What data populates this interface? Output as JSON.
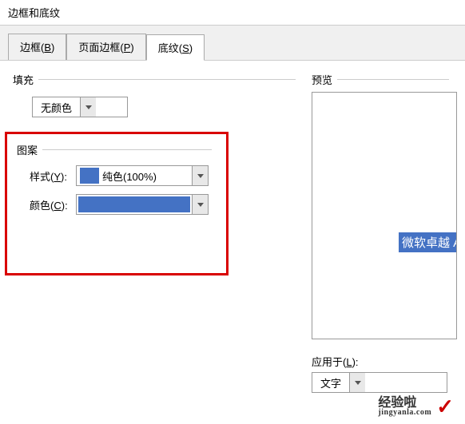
{
  "window": {
    "title": "边框和底纹"
  },
  "tabs": {
    "border": {
      "label": "边框(",
      "key": "B",
      "suffix": ")"
    },
    "page_border": {
      "label": "页面边框(",
      "key": "P",
      "suffix": ")"
    },
    "shading": {
      "label": "底纹(",
      "key": "S",
      "suffix": ")"
    }
  },
  "fill": {
    "group_label": "填充",
    "value": "无颜色"
  },
  "pattern": {
    "group_label": "图案",
    "style": {
      "label": "样式(",
      "key": "Y",
      "suffix": "):",
      "value": "纯色(100%)",
      "swatch_color": "#4472c4"
    },
    "color": {
      "label": "颜色(",
      "key": "C",
      "suffix": "):",
      "value_color": "#4472c4"
    }
  },
  "preview": {
    "group_label": "预览",
    "sample_text": "微软卓越 Aa"
  },
  "apply": {
    "label": "应用于(",
    "key": "L",
    "suffix": "):",
    "value": "文字"
  },
  "watermark": {
    "top": "经验啦",
    "bottom": "jingyanla.com"
  }
}
